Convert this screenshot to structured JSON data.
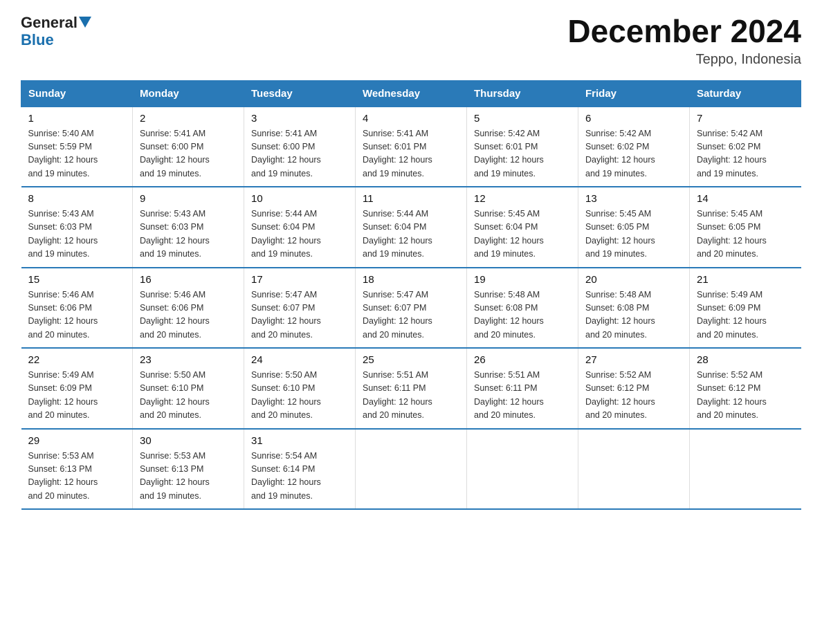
{
  "logo": {
    "text_general": "General",
    "triangle_color": "#1a6fad",
    "text_blue": "Blue"
  },
  "title": "December 2024",
  "subtitle": "Teppo, Indonesia",
  "days_of_week": [
    "Sunday",
    "Monday",
    "Tuesday",
    "Wednesday",
    "Thursday",
    "Friday",
    "Saturday"
  ],
  "weeks": [
    [
      {
        "day": "1",
        "sunrise": "5:40 AM",
        "sunset": "5:59 PM",
        "daylight": "12 hours and 19 minutes."
      },
      {
        "day": "2",
        "sunrise": "5:41 AM",
        "sunset": "6:00 PM",
        "daylight": "12 hours and 19 minutes."
      },
      {
        "day": "3",
        "sunrise": "5:41 AM",
        "sunset": "6:00 PM",
        "daylight": "12 hours and 19 minutes."
      },
      {
        "day": "4",
        "sunrise": "5:41 AM",
        "sunset": "6:01 PM",
        "daylight": "12 hours and 19 minutes."
      },
      {
        "day": "5",
        "sunrise": "5:42 AM",
        "sunset": "6:01 PM",
        "daylight": "12 hours and 19 minutes."
      },
      {
        "day": "6",
        "sunrise": "5:42 AM",
        "sunset": "6:02 PM",
        "daylight": "12 hours and 19 minutes."
      },
      {
        "day": "7",
        "sunrise": "5:42 AM",
        "sunset": "6:02 PM",
        "daylight": "12 hours and 19 minutes."
      }
    ],
    [
      {
        "day": "8",
        "sunrise": "5:43 AM",
        "sunset": "6:03 PM",
        "daylight": "12 hours and 19 minutes."
      },
      {
        "day": "9",
        "sunrise": "5:43 AM",
        "sunset": "6:03 PM",
        "daylight": "12 hours and 19 minutes."
      },
      {
        "day": "10",
        "sunrise": "5:44 AM",
        "sunset": "6:04 PM",
        "daylight": "12 hours and 19 minutes."
      },
      {
        "day": "11",
        "sunrise": "5:44 AM",
        "sunset": "6:04 PM",
        "daylight": "12 hours and 19 minutes."
      },
      {
        "day": "12",
        "sunrise": "5:45 AM",
        "sunset": "6:04 PM",
        "daylight": "12 hours and 19 minutes."
      },
      {
        "day": "13",
        "sunrise": "5:45 AM",
        "sunset": "6:05 PM",
        "daylight": "12 hours and 19 minutes."
      },
      {
        "day": "14",
        "sunrise": "5:45 AM",
        "sunset": "6:05 PM",
        "daylight": "12 hours and 20 minutes."
      }
    ],
    [
      {
        "day": "15",
        "sunrise": "5:46 AM",
        "sunset": "6:06 PM",
        "daylight": "12 hours and 20 minutes."
      },
      {
        "day": "16",
        "sunrise": "5:46 AM",
        "sunset": "6:06 PM",
        "daylight": "12 hours and 20 minutes."
      },
      {
        "day": "17",
        "sunrise": "5:47 AM",
        "sunset": "6:07 PM",
        "daylight": "12 hours and 20 minutes."
      },
      {
        "day": "18",
        "sunrise": "5:47 AM",
        "sunset": "6:07 PM",
        "daylight": "12 hours and 20 minutes."
      },
      {
        "day": "19",
        "sunrise": "5:48 AM",
        "sunset": "6:08 PM",
        "daylight": "12 hours and 20 minutes."
      },
      {
        "day": "20",
        "sunrise": "5:48 AM",
        "sunset": "6:08 PM",
        "daylight": "12 hours and 20 minutes."
      },
      {
        "day": "21",
        "sunrise": "5:49 AM",
        "sunset": "6:09 PM",
        "daylight": "12 hours and 20 minutes."
      }
    ],
    [
      {
        "day": "22",
        "sunrise": "5:49 AM",
        "sunset": "6:09 PM",
        "daylight": "12 hours and 20 minutes."
      },
      {
        "day": "23",
        "sunrise": "5:50 AM",
        "sunset": "6:10 PM",
        "daylight": "12 hours and 20 minutes."
      },
      {
        "day": "24",
        "sunrise": "5:50 AM",
        "sunset": "6:10 PM",
        "daylight": "12 hours and 20 minutes."
      },
      {
        "day": "25",
        "sunrise": "5:51 AM",
        "sunset": "6:11 PM",
        "daylight": "12 hours and 20 minutes."
      },
      {
        "day": "26",
        "sunrise": "5:51 AM",
        "sunset": "6:11 PM",
        "daylight": "12 hours and 20 minutes."
      },
      {
        "day": "27",
        "sunrise": "5:52 AM",
        "sunset": "6:12 PM",
        "daylight": "12 hours and 20 minutes."
      },
      {
        "day": "28",
        "sunrise": "5:52 AM",
        "sunset": "6:12 PM",
        "daylight": "12 hours and 20 minutes."
      }
    ],
    [
      {
        "day": "29",
        "sunrise": "5:53 AM",
        "sunset": "6:13 PM",
        "daylight": "12 hours and 20 minutes."
      },
      {
        "day": "30",
        "sunrise": "5:53 AM",
        "sunset": "6:13 PM",
        "daylight": "12 hours and 19 minutes."
      },
      {
        "day": "31",
        "sunrise": "5:54 AM",
        "sunset": "6:14 PM",
        "daylight": "12 hours and 19 minutes."
      },
      null,
      null,
      null,
      null
    ]
  ],
  "labels": {
    "sunrise": "Sunrise:",
    "sunset": "Sunset:",
    "daylight": "Daylight:"
  }
}
